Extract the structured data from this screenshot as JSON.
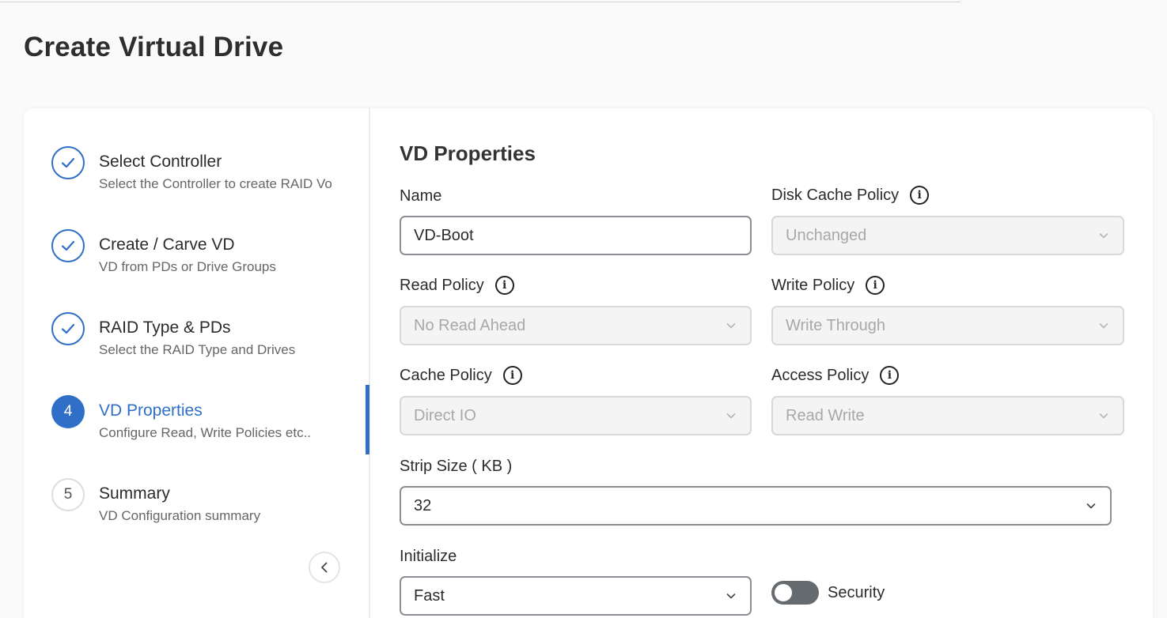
{
  "page": {
    "title": "Create Virtual Drive"
  },
  "stepper": {
    "steps": [
      {
        "num": "",
        "title": "Select Controller",
        "subtitle": "Select the Controller to create RAID Vo",
        "state": "done"
      },
      {
        "num": "",
        "title": "Create / Carve VD",
        "subtitle": "VD from PDs or Drive Groups",
        "state": "done"
      },
      {
        "num": "",
        "title": "RAID Type & PDs",
        "subtitle": "Select the RAID Type and Drives",
        "state": "done"
      },
      {
        "num": "4",
        "title": "VD Properties",
        "subtitle": "Configure Read, Write Policies etc..",
        "state": "active"
      },
      {
        "num": "5",
        "title": "Summary",
        "subtitle": "VD Configuration summary",
        "state": "pending"
      }
    ],
    "collapse_icon": "chevron-left-icon"
  },
  "form": {
    "section_title": "VD Properties",
    "name": {
      "label": "Name",
      "value": "VD-Boot"
    },
    "disk_cache_policy": {
      "label": "Disk Cache Policy",
      "value": "Unchanged"
    },
    "read_policy": {
      "label": "Read Policy",
      "value": "No Read Ahead"
    },
    "write_policy": {
      "label": "Write Policy",
      "value": "Write Through"
    },
    "cache_policy": {
      "label": "Cache Policy",
      "value": "Direct IO"
    },
    "access_policy": {
      "label": "Access Policy",
      "value": "Read Write"
    },
    "strip_size": {
      "label": "Strip Size ( KB )",
      "value": "32"
    },
    "initialize": {
      "label": "Initialize",
      "value": "Fast"
    },
    "security": {
      "label": "Security",
      "enabled": false
    }
  },
  "colors": {
    "accent": "#2f6fc7",
    "toggle_off": "#666b70"
  }
}
